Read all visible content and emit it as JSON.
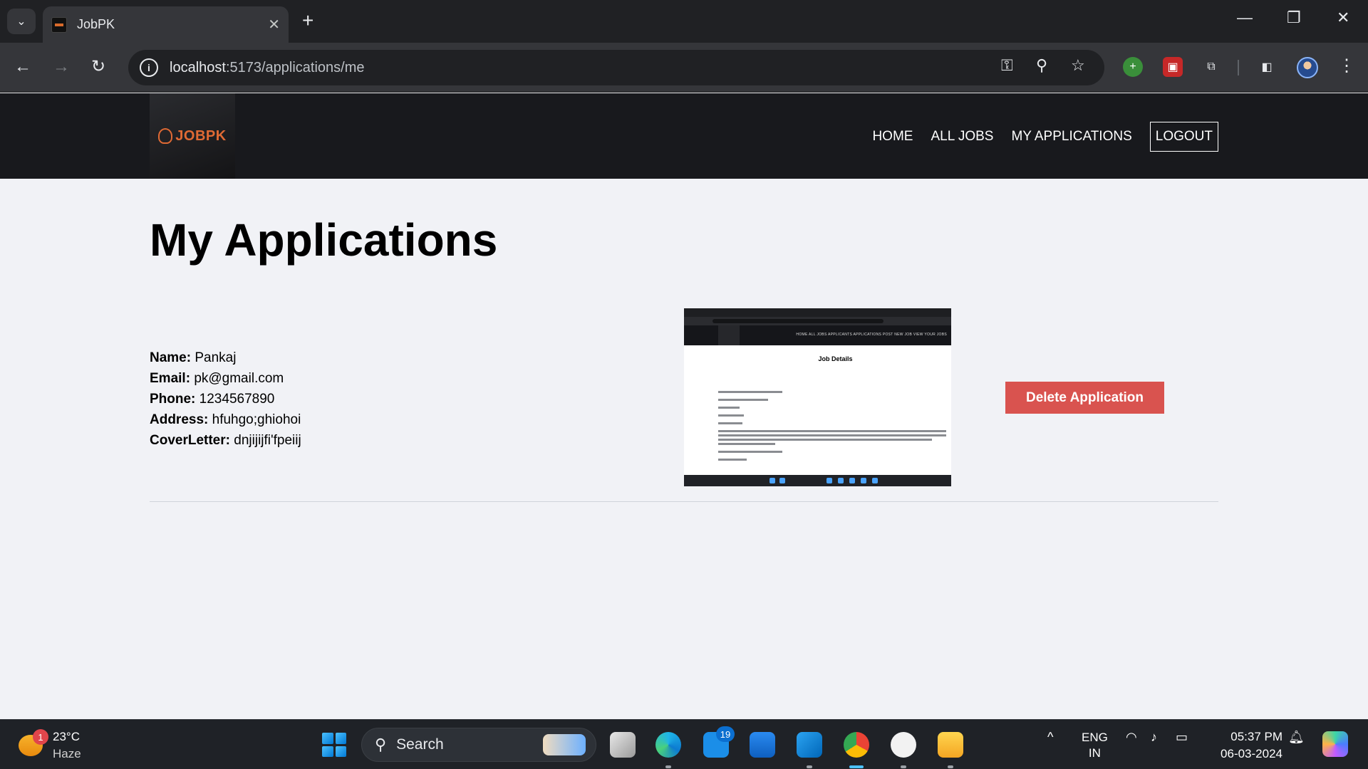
{
  "browser": {
    "tab_title": "JobPK",
    "url_host": "localhost",
    "url_path": ":5173/applications/me",
    "new_tab_glyph": "+",
    "tab_close_glyph": "✕",
    "back_glyph": "←",
    "forward_glyph": "→",
    "reload_glyph": "↻",
    "minimize_glyph": "—",
    "restore_glyph": "❐",
    "close_glyph": "✕",
    "menu_glyph": "⋮"
  },
  "app": {
    "logo_text": "JOBPK",
    "nav": {
      "home": "HOME",
      "all_jobs": "ALL JOBS",
      "my_applications": "MY APPLICATIONS",
      "logout": "LOGOUT"
    },
    "page_title": "My Applications"
  },
  "application": {
    "name_label": "Name:",
    "name": "Pankaj",
    "email_label": "Email:",
    "email": "pk@gmail.com",
    "phone_label": "Phone:",
    "phone": "1234567890",
    "address_label": "Address:",
    "address": "hfuhgo;ghiohoi",
    "cover_label": "CoverLetter:",
    "cover": "dnjijijfi'fpeiij",
    "resume_caption": "Job Details",
    "resume_nav": "HOME  ALL JOBS  APPLICANTS APPLICATIONS  POST NEW JOB  VIEW YOUR JOBS",
    "delete_label": "Delete Application"
  },
  "taskbar": {
    "weather_temp": "23°C",
    "weather_desc": "Haze",
    "weather_badge": "1",
    "search_label": "Search",
    "mail_badge": "19",
    "lang_line1": "ENG",
    "lang_line2": "IN",
    "time": "05:37 PM",
    "date": "06-03-2024",
    "tray_up_glyph": "^"
  },
  "colors": {
    "accent": "#e06a34",
    "delete": "#d9534f",
    "header_bg": "#18191d",
    "page_bg": "#f1f2f6"
  }
}
